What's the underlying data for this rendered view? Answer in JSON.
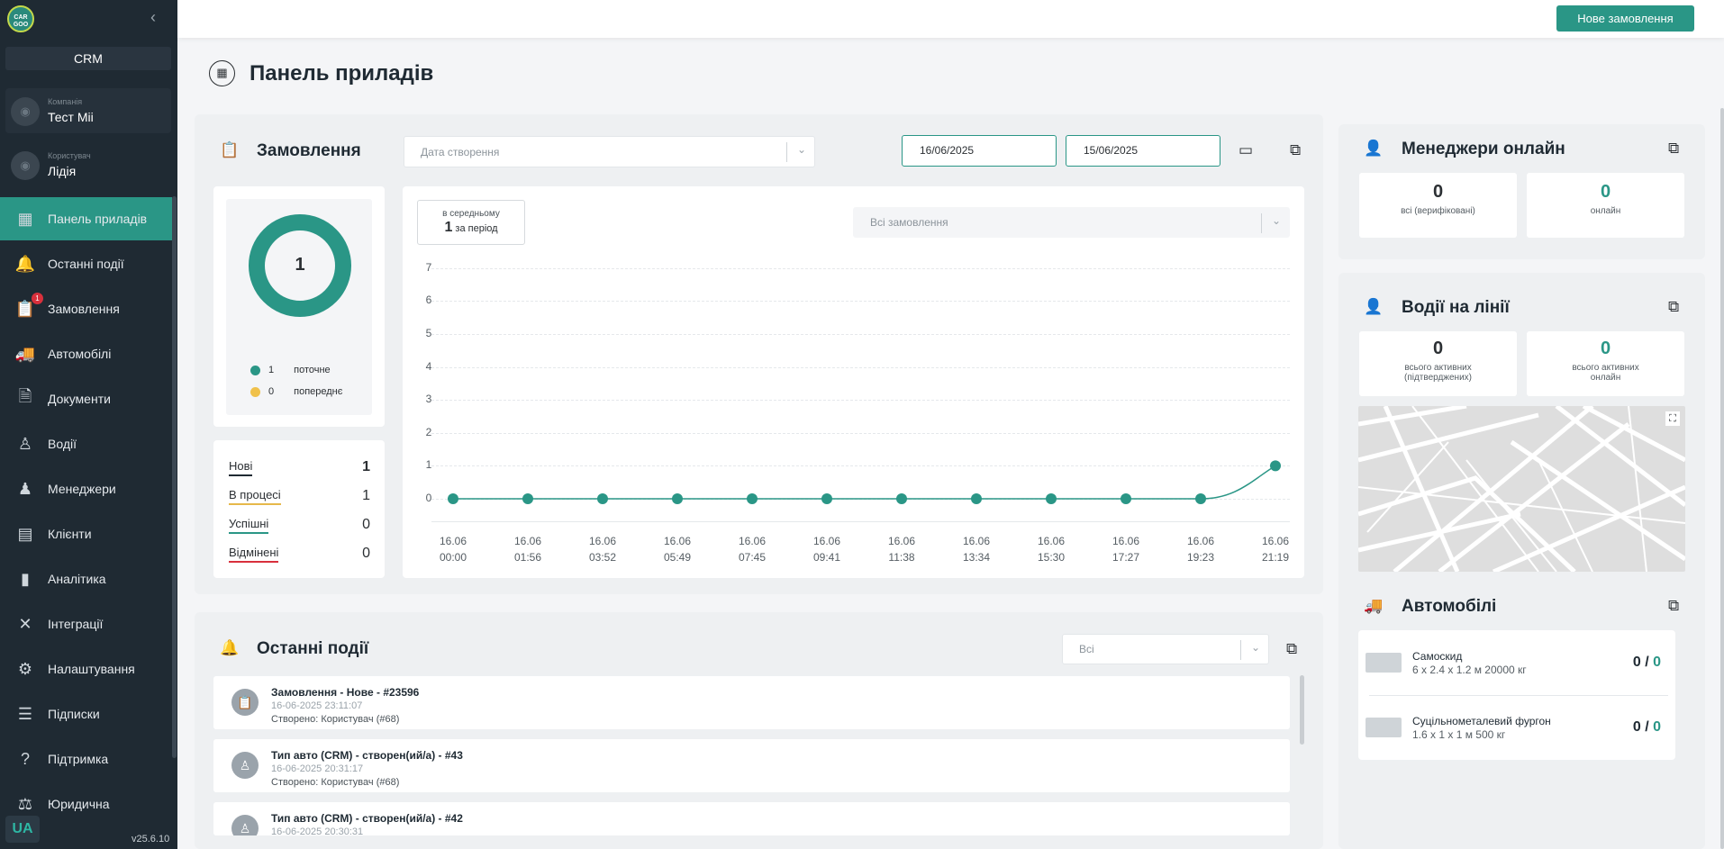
{
  "sidebar": {
    "logo": {
      "top": "CAR",
      "bottom": "GOO"
    },
    "crm_label": "CRM",
    "company": {
      "caption": "Компанія",
      "name": "Тест Mii"
    },
    "user": {
      "caption": "Користувач",
      "name": "Лідія"
    },
    "items": [
      {
        "label": "Панель приладів",
        "icon": "dashboard-icon"
      },
      {
        "label": "Останні події",
        "icon": "bell-icon"
      },
      {
        "label": "Замовлення",
        "icon": "clipboard-icon",
        "badge": "1"
      },
      {
        "label": "Автомобілі",
        "icon": "truck-icon"
      },
      {
        "label": "Документи",
        "icon": "document-icon"
      },
      {
        "label": "Водії",
        "icon": "driver-icon"
      },
      {
        "label": "Менеджери",
        "icon": "manager-icon"
      },
      {
        "label": "Клієнти",
        "icon": "client-icon"
      },
      {
        "label": "Аналітика",
        "icon": "chart-icon"
      },
      {
        "label": "Інтеграції",
        "icon": "integration-icon"
      },
      {
        "label": "Налаштування",
        "icon": "gear-icon"
      },
      {
        "label": "Підписки",
        "icon": "subscription-icon"
      },
      {
        "label": "Підтримка",
        "icon": "help-icon"
      },
      {
        "label": "Юридична",
        "icon": "legal-icon"
      }
    ],
    "lang": "UA",
    "version": "v25.6.10"
  },
  "topbar": {
    "new_order": "Нове замовлення"
  },
  "page": {
    "title": "Панель приладів"
  },
  "orders": {
    "title": "Замовлення",
    "date_filter_placeholder": "Дата створення",
    "date_from": "16/06/2025",
    "date_to": "15/06/2025",
    "donut": {
      "total": "1",
      "legend": [
        {
          "value": "1",
          "label": "поточне",
          "color": "#2a9686"
        },
        {
          "value": "0",
          "label": "попереднє",
          "color": "#f0c14b"
        }
      ]
    },
    "statuses": [
      {
        "label": "Нові",
        "value": "1",
        "color": "#1f2a33"
      },
      {
        "label": "В процесі",
        "value": "1",
        "color": "#e6b84a"
      },
      {
        "label": "Успішні",
        "value": "0",
        "color": "#2a9686"
      },
      {
        "label": "Відмінені",
        "value": "0",
        "color": "#d8303c"
      }
    ],
    "avg": {
      "top": "в середньому",
      "value": "1",
      "bottom": "за період"
    },
    "all_orders_placeholder": "Всі замовлення"
  },
  "chart_data": {
    "type": "line",
    "x": [
      "16.06 00:00",
      "16.06 01:56",
      "16.06 03:52",
      "16.06 05:49",
      "16.06 07:45",
      "16.06 09:41",
      "16.06 11:38",
      "16.06 13:34",
      "16.06 15:30",
      "16.06 17:27",
      "16.06 19:23",
      "16.06 21:19"
    ],
    "y": [
      0,
      0,
      0,
      0,
      0,
      0,
      0,
      0,
      0,
      0,
      0,
      1
    ],
    "ylim": [
      0,
      7
    ],
    "yticks": [
      0,
      1,
      2,
      3,
      4,
      5,
      6,
      7
    ],
    "grid": true,
    "color": "#2a9686",
    "title": "",
    "xlabel": "",
    "ylabel": ""
  },
  "events": {
    "title": "Останні події",
    "filter": "Всі",
    "items": [
      {
        "title": "Замовлення - Нове - #23596",
        "date": "16-06-2025 23:11:07",
        "by": "Створено: Користувач (#68)",
        "icon": "clipboard-icon"
      },
      {
        "title": "Тип авто (CRM) - створен(ий/а) - #43",
        "date": "16-06-2025 20:31:17",
        "by": "Створено: Користувач (#68)",
        "icon": "driver-icon"
      },
      {
        "title": "Тип авто (CRM) - створен(ий/а) - #42",
        "date": "16-06-2025 20:30:31",
        "by": "",
        "icon": "driver-icon"
      }
    ]
  },
  "managers": {
    "title": "Менеджери онлайн",
    "all_value": "0",
    "all_label": "всі (верифіковані)",
    "online_value": "0",
    "online_label": "онлайн"
  },
  "drivers": {
    "title": "Водії на лінії",
    "active_value": "0",
    "active_label": "всього активних (підтверджених)",
    "online_value": "0",
    "online_label": "всього активних онлайн"
  },
  "cars": {
    "title": "Автомобілі",
    "items": [
      {
        "name": "Самоскид",
        "dims": "6 x 2.4 x 1.2 м 20000 кг",
        "used": "0",
        "total": "0"
      },
      {
        "name": "Суцільнометалевий фургон",
        "dims": "1.6 x 1 x 1 м 500 кг",
        "used": "0",
        "total": "0"
      }
    ]
  }
}
